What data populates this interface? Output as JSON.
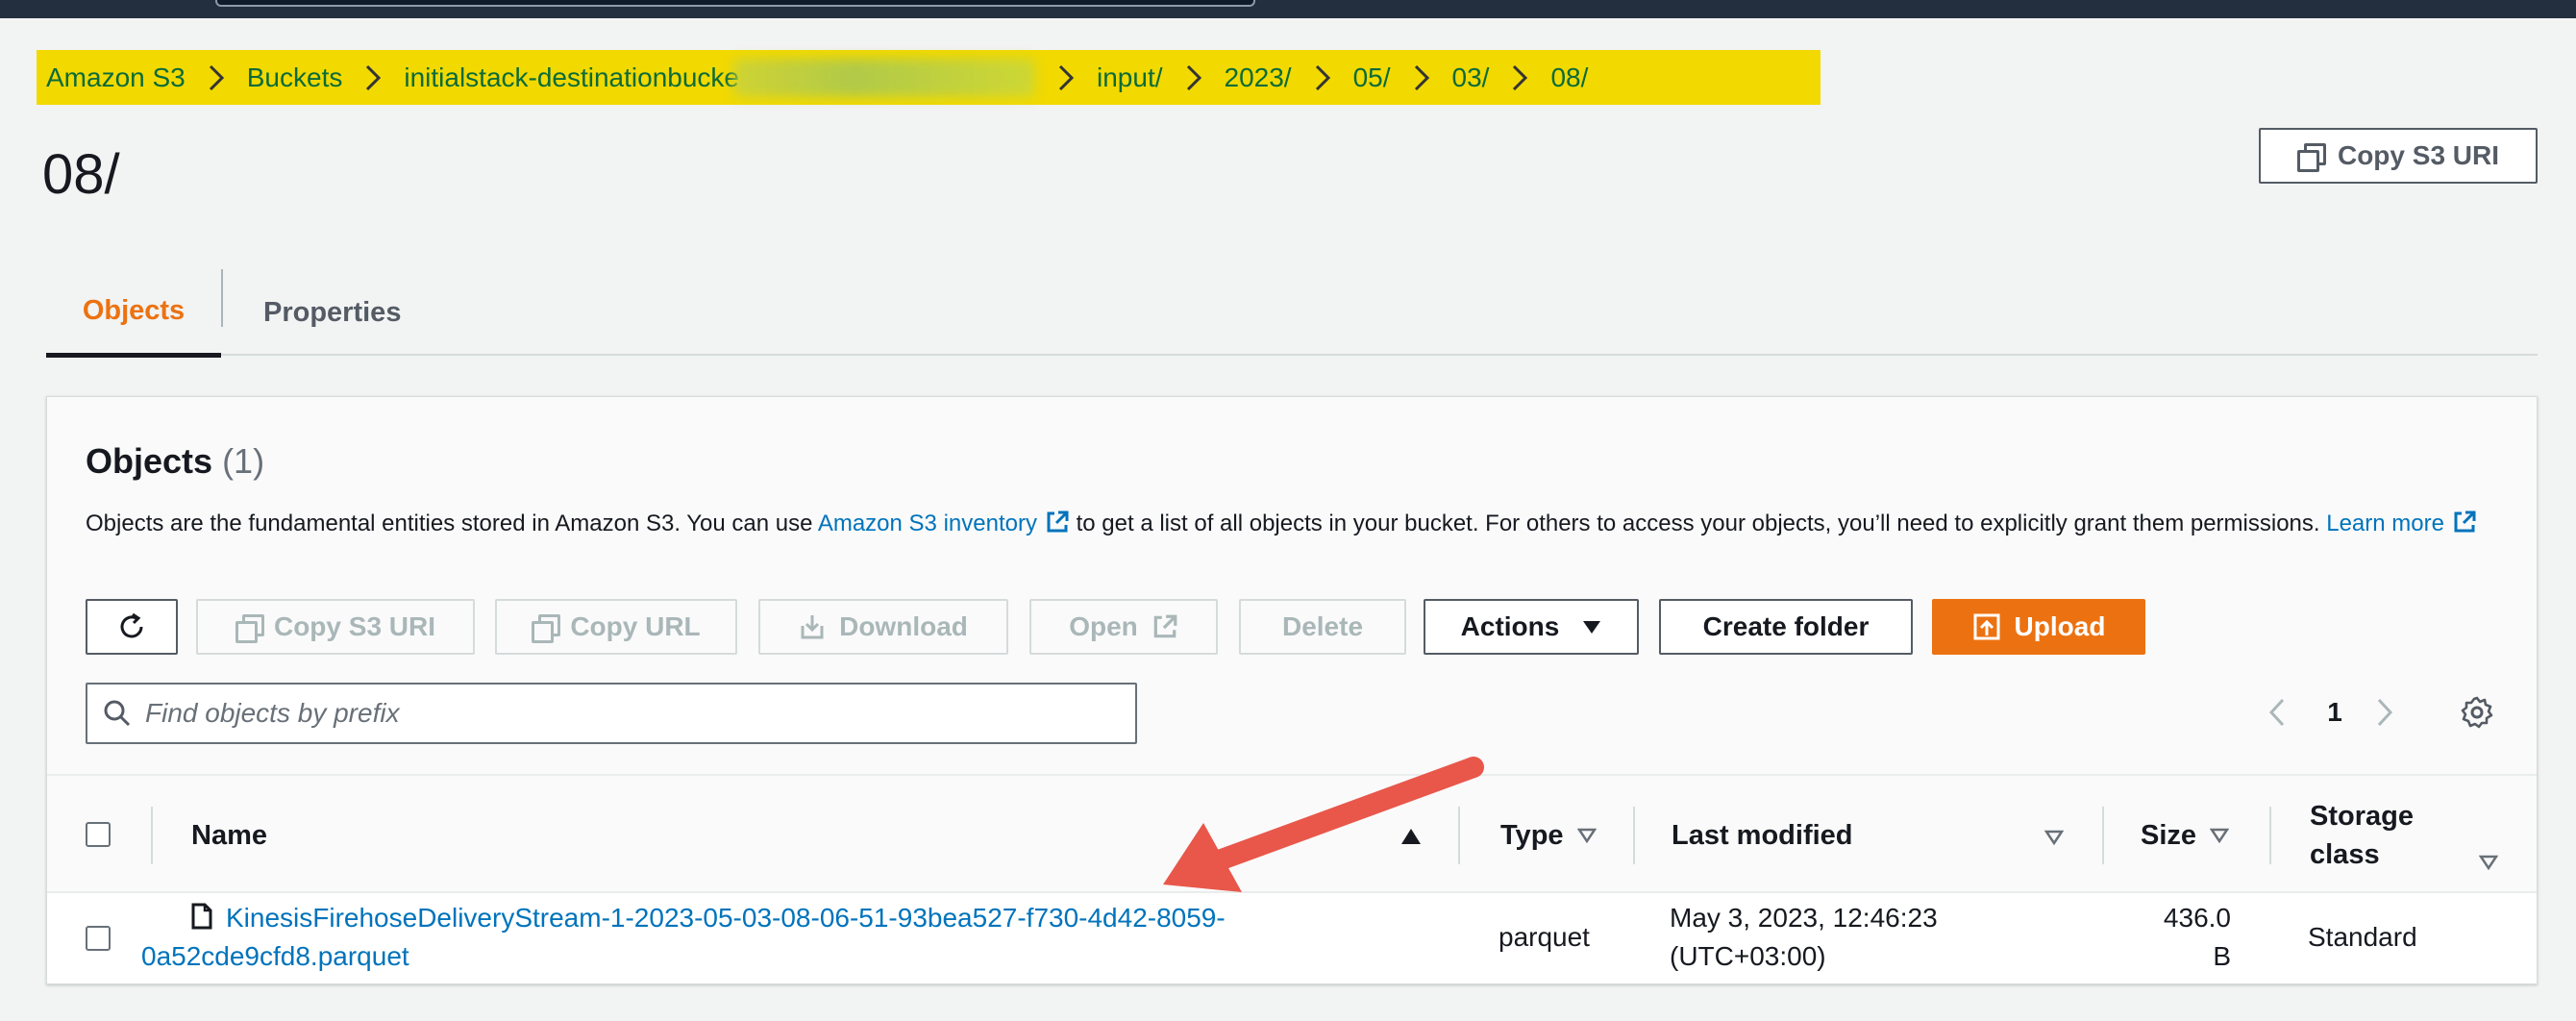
{
  "breadcrumb": {
    "items": [
      "Amazon S3",
      "Buckets",
      "initialstack-destinationbucke",
      "input/",
      "2023/",
      "05/",
      "03/",
      "08/"
    ]
  },
  "header": {
    "title": "08/",
    "copy_uri_label": "Copy S3 URI"
  },
  "tabs": [
    {
      "label": "Objects",
      "active": true
    },
    {
      "label": "Properties",
      "active": false
    }
  ],
  "objects_panel": {
    "title": "Objects",
    "count": "(1)",
    "description_pre": "Objects are the fundamental entities stored in Amazon S3. You can use ",
    "inventory_link": "Amazon S3 inventory",
    "description_mid": " to get a list of all objects in your bucket. For others to access your objects, you’ll need to explicitly grant them permissions. ",
    "learn_more": "Learn more"
  },
  "toolbar": {
    "refresh_icon": "refresh-icon",
    "copy_s3_uri": "Copy S3 URI",
    "copy_url": "Copy URL",
    "download": "Download",
    "open": "Open",
    "delete": "Delete",
    "actions": "Actions",
    "create_folder": "Create folder",
    "upload": "Upload"
  },
  "search": {
    "placeholder": "Find objects by prefix",
    "value": ""
  },
  "pagination": {
    "current_page": "1"
  },
  "table": {
    "columns": [
      "Name",
      "Type",
      "Last modified",
      "Size",
      "Storage class"
    ],
    "rows": [
      {
        "name_line1": "KinesisFirehoseDeliveryStream-1-2023-05-03-08-06-51-93bea527-f730-4d42-8059-",
        "name_line2": "0a52cde9cfd8.parquet",
        "type": "parquet",
        "last_modified_line1": "May 3, 2023, 12:46:23",
        "last_modified_line2": "(UTC+03:00)",
        "size_line1": "436.0",
        "size_line2": "B",
        "storage_class": "Standard"
      }
    ]
  },
  "colors": {
    "accent": "#ec7211",
    "link": "#0073bb",
    "breadcrumb_highlight": "#f2d900",
    "annotation_arrow": "#e8574a"
  }
}
